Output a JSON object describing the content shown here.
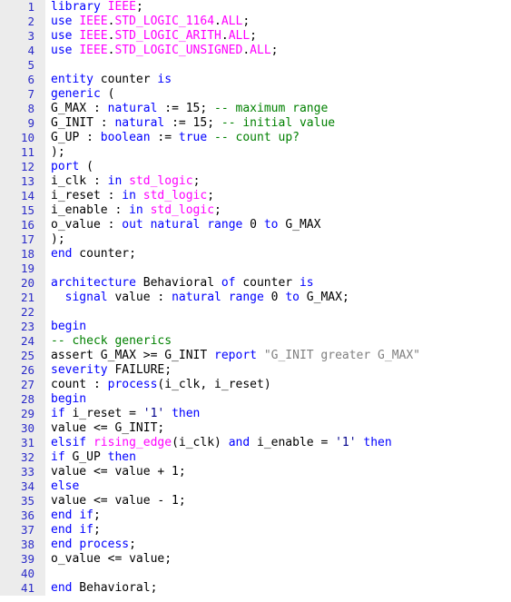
{
  "editor": {
    "language": "VHDL",
    "colors": {
      "background": "#ffffff",
      "gutter_background": "#ececec",
      "line_number": "#2a2ac8",
      "keyword": "#0000ff",
      "library": "#ff00ff",
      "comment": "#008000",
      "string": "#808080",
      "plain": "#000000"
    },
    "first_line": 1,
    "last_line": 41,
    "lines": [
      {
        "n": "1",
        "tokens": [
          {
            "t": "kw",
            "v": "library"
          },
          {
            "t": "pln",
            "v": " "
          },
          {
            "t": "lib",
            "v": "IEEE"
          },
          {
            "t": "pln",
            "v": ";"
          }
        ]
      },
      {
        "n": "2",
        "tokens": [
          {
            "t": "kw",
            "v": "use"
          },
          {
            "t": "pln",
            "v": " "
          },
          {
            "t": "lib",
            "v": "IEEE"
          },
          {
            "t": "pln",
            "v": "."
          },
          {
            "t": "lib",
            "v": "STD_LOGIC_1164"
          },
          {
            "t": "pln",
            "v": "."
          },
          {
            "t": "lib",
            "v": "ALL"
          },
          {
            "t": "pln",
            "v": ";"
          }
        ]
      },
      {
        "n": "3",
        "tokens": [
          {
            "t": "kw",
            "v": "use"
          },
          {
            "t": "pln",
            "v": " "
          },
          {
            "t": "lib",
            "v": "IEEE"
          },
          {
            "t": "pln",
            "v": "."
          },
          {
            "t": "lib",
            "v": "STD_LOGIC_ARITH"
          },
          {
            "t": "pln",
            "v": "."
          },
          {
            "t": "lib",
            "v": "ALL"
          },
          {
            "t": "pln",
            "v": ";"
          }
        ]
      },
      {
        "n": "4",
        "tokens": [
          {
            "t": "kw",
            "v": "use"
          },
          {
            "t": "pln",
            "v": " "
          },
          {
            "t": "lib",
            "v": "IEEE"
          },
          {
            "t": "pln",
            "v": "."
          },
          {
            "t": "lib",
            "v": "STD_LOGIC_UNSIGNED"
          },
          {
            "t": "pln",
            "v": "."
          },
          {
            "t": "lib",
            "v": "ALL"
          },
          {
            "t": "pln",
            "v": ";"
          }
        ]
      },
      {
        "n": "5",
        "tokens": []
      },
      {
        "n": "6",
        "tokens": [
          {
            "t": "kw",
            "v": "entity"
          },
          {
            "t": "pln",
            "v": " counter "
          },
          {
            "t": "kw",
            "v": "is"
          }
        ]
      },
      {
        "n": "7",
        "tokens": [
          {
            "t": "kw",
            "v": "generic"
          },
          {
            "t": "pln",
            "v": " ("
          }
        ]
      },
      {
        "n": "8",
        "tokens": [
          {
            "t": "pln",
            "v": "G_MAX : "
          },
          {
            "t": "kw",
            "v": "natural"
          },
          {
            "t": "pln",
            "v": " := 15; "
          },
          {
            "t": "cmt",
            "v": "-- maximum range"
          }
        ]
      },
      {
        "n": "9",
        "tokens": [
          {
            "t": "pln",
            "v": "G_INIT : "
          },
          {
            "t": "kw",
            "v": "natural"
          },
          {
            "t": "pln",
            "v": " := 15; "
          },
          {
            "t": "cmt",
            "v": "-- initial value"
          }
        ]
      },
      {
        "n": "10",
        "tokens": [
          {
            "t": "pln",
            "v": "G_UP : "
          },
          {
            "t": "kw",
            "v": "boolean"
          },
          {
            "t": "pln",
            "v": " := "
          },
          {
            "t": "kw",
            "v": "true"
          },
          {
            "t": "pln",
            "v": " "
          },
          {
            "t": "cmt",
            "v": "-- count up?"
          }
        ]
      },
      {
        "n": "11",
        "tokens": [
          {
            "t": "pln",
            "v": ");"
          }
        ]
      },
      {
        "n": "12",
        "tokens": [
          {
            "t": "kw",
            "v": "port"
          },
          {
            "t": "pln",
            "v": " ("
          }
        ]
      },
      {
        "n": "13",
        "tokens": [
          {
            "t": "pln",
            "v": "i_clk : "
          },
          {
            "t": "kw",
            "v": "in"
          },
          {
            "t": "pln",
            "v": " "
          },
          {
            "t": "lib",
            "v": "std_logic"
          },
          {
            "t": "pln",
            "v": ";"
          }
        ]
      },
      {
        "n": "14",
        "tokens": [
          {
            "t": "pln",
            "v": "i_reset : "
          },
          {
            "t": "kw",
            "v": "in"
          },
          {
            "t": "pln",
            "v": " "
          },
          {
            "t": "lib",
            "v": "std_logic"
          },
          {
            "t": "pln",
            "v": ";"
          }
        ]
      },
      {
        "n": "15",
        "tokens": [
          {
            "t": "pln",
            "v": "i_enable : "
          },
          {
            "t": "kw",
            "v": "in"
          },
          {
            "t": "pln",
            "v": " "
          },
          {
            "t": "lib",
            "v": "std_logic"
          },
          {
            "t": "pln",
            "v": ";"
          }
        ]
      },
      {
        "n": "16",
        "tokens": [
          {
            "t": "pln",
            "v": "o_value : "
          },
          {
            "t": "kw",
            "v": "out"
          },
          {
            "t": "pln",
            "v": " "
          },
          {
            "t": "kw",
            "v": "natural"
          },
          {
            "t": "pln",
            "v": " "
          },
          {
            "t": "kw",
            "v": "range"
          },
          {
            "t": "pln",
            "v": " 0 "
          },
          {
            "t": "kw",
            "v": "to"
          },
          {
            "t": "pln",
            "v": " G_MAX"
          }
        ]
      },
      {
        "n": "17",
        "tokens": [
          {
            "t": "pln",
            "v": ");"
          }
        ]
      },
      {
        "n": "18",
        "tokens": [
          {
            "t": "kw",
            "v": "end"
          },
          {
            "t": "pln",
            "v": " counter;"
          }
        ]
      },
      {
        "n": "19",
        "tokens": []
      },
      {
        "n": "20",
        "tokens": [
          {
            "t": "kw",
            "v": "architecture"
          },
          {
            "t": "pln",
            "v": " Behavioral "
          },
          {
            "t": "kw",
            "v": "of"
          },
          {
            "t": "pln",
            "v": " counter "
          },
          {
            "t": "kw",
            "v": "is"
          }
        ]
      },
      {
        "n": "21",
        "tokens": [
          {
            "t": "pln",
            "v": "  "
          },
          {
            "t": "kw",
            "v": "signal"
          },
          {
            "t": "pln",
            "v": " value : "
          },
          {
            "t": "kw",
            "v": "natural"
          },
          {
            "t": "pln",
            "v": " "
          },
          {
            "t": "kw",
            "v": "range"
          },
          {
            "t": "pln",
            "v": " 0 "
          },
          {
            "t": "kw",
            "v": "to"
          },
          {
            "t": "pln",
            "v": " G_MAX;"
          }
        ]
      },
      {
        "n": "22",
        "tokens": []
      },
      {
        "n": "23",
        "tokens": [
          {
            "t": "kw",
            "v": "begin"
          }
        ]
      },
      {
        "n": "24",
        "tokens": [
          {
            "t": "cmt",
            "v": "-- check generics"
          }
        ]
      },
      {
        "n": "25",
        "tokens": [
          {
            "t": "pln",
            "v": "assert G_MAX >= G_INIT "
          },
          {
            "t": "kw",
            "v": "report"
          },
          {
            "t": "pln",
            "v": " "
          },
          {
            "t": "str",
            "v": "\"G_INIT greater G_MAX\""
          }
        ]
      },
      {
        "n": "26",
        "tokens": [
          {
            "t": "kw",
            "v": "severity"
          },
          {
            "t": "pln",
            "v": " FAILURE;"
          }
        ]
      },
      {
        "n": "27",
        "tokens": [
          {
            "t": "pln",
            "v": "count : "
          },
          {
            "t": "kw",
            "v": "process"
          },
          {
            "t": "pln",
            "v": "(i_clk, i_reset)"
          }
        ]
      },
      {
        "n": "28",
        "tokens": [
          {
            "t": "kw",
            "v": "begin"
          }
        ]
      },
      {
        "n": "29",
        "tokens": [
          {
            "t": "kw",
            "v": "if"
          },
          {
            "t": "pln",
            "v": " i_reset = "
          },
          {
            "t": "chr",
            "v": "'1'"
          },
          {
            "t": "pln",
            "v": " "
          },
          {
            "t": "kw",
            "v": "then"
          }
        ]
      },
      {
        "n": "30",
        "tokens": [
          {
            "t": "pln",
            "v": "value <= G_INIT;"
          }
        ]
      },
      {
        "n": "31",
        "tokens": [
          {
            "t": "kw",
            "v": "elsif"
          },
          {
            "t": "pln",
            "v": " "
          },
          {
            "t": "lib",
            "v": "rising_edge"
          },
          {
            "t": "pln",
            "v": "(i_clk) "
          },
          {
            "t": "kw",
            "v": "and"
          },
          {
            "t": "pln",
            "v": " i_enable = "
          },
          {
            "t": "chr",
            "v": "'1'"
          },
          {
            "t": "pln",
            "v": " "
          },
          {
            "t": "kw",
            "v": "then"
          }
        ]
      },
      {
        "n": "32",
        "tokens": [
          {
            "t": "kw",
            "v": "if"
          },
          {
            "t": "pln",
            "v": " G_UP "
          },
          {
            "t": "kw",
            "v": "then"
          }
        ]
      },
      {
        "n": "33",
        "tokens": [
          {
            "t": "pln",
            "v": "value <= value + 1;"
          }
        ]
      },
      {
        "n": "34",
        "tokens": [
          {
            "t": "kw",
            "v": "else"
          }
        ]
      },
      {
        "n": "35",
        "tokens": [
          {
            "t": "pln",
            "v": "value <= value - 1;"
          }
        ]
      },
      {
        "n": "36",
        "tokens": [
          {
            "t": "kw",
            "v": "end"
          },
          {
            "t": "pln",
            "v": " "
          },
          {
            "t": "kw",
            "v": "if"
          },
          {
            "t": "pln",
            "v": ";"
          }
        ]
      },
      {
        "n": "37",
        "tokens": [
          {
            "t": "kw",
            "v": "end"
          },
          {
            "t": "pln",
            "v": " "
          },
          {
            "t": "kw",
            "v": "if"
          },
          {
            "t": "pln",
            "v": ";"
          }
        ]
      },
      {
        "n": "38",
        "tokens": [
          {
            "t": "kw",
            "v": "end"
          },
          {
            "t": "pln",
            "v": " "
          },
          {
            "t": "kw",
            "v": "process"
          },
          {
            "t": "pln",
            "v": ";"
          }
        ]
      },
      {
        "n": "39",
        "tokens": [
          {
            "t": "pln",
            "v": "o_value <= value;"
          }
        ]
      },
      {
        "n": "40",
        "tokens": []
      },
      {
        "n": "41",
        "tokens": [
          {
            "t": "kw",
            "v": "end"
          },
          {
            "t": "pln",
            "v": " Behavioral;"
          }
        ]
      }
    ]
  }
}
